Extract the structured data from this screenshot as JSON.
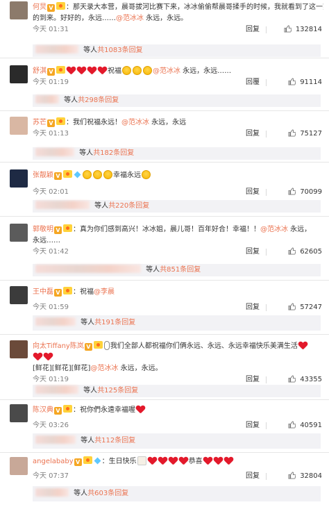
{
  "comments": [
    {
      "name": "何炅",
      "text": "：那天录大本营，晨哥拔河比赛下来，冰冰偷偷帮晨哥揉手的时候，我就看到了这一刻",
      "text2": "的到来。好好的，永远……",
      "mention": "@范冰冰",
      "after_mention": " 永远，永远。",
      "time": "今天 01:31",
      "reply": "回复",
      "likes": "132814",
      "sub_suffix": " 等人",
      "sub_count": "共1083条回复",
      "avatar_color": "#8c7a6b"
    },
    {
      "name": "舒淇",
      "text": "祝福",
      "mention": "@范冰冰",
      "after_mention": " 永远，永远……",
      "time": "今天 01:19",
      "reply": "回覆",
      "likes": "91114",
      "sub_suffix": " 等人",
      "sub_count": "共298条回复",
      "avatar_color": "#2a2a2a"
    },
    {
      "name": "苏芒",
      "text": "：我们祝福永远！",
      "mention": "@范冰冰",
      "after_mention": " 永远，永远",
      "time": "今天 01:13",
      "reply": "回复",
      "likes": "75127",
      "sub_suffix": " 等人",
      "sub_count": "共182条回复",
      "avatar_color": "#d9b7a3"
    },
    {
      "name": "张靓颖",
      "text": "幸福永远",
      "time": "今天 02:01",
      "reply": "回复",
      "likes": "70099",
      "sub_suffix": " 等人",
      "sub_count": "共220条回复",
      "avatar_color": "#1e2a44"
    },
    {
      "name": "郭敬明",
      "text": "：真为你们感到高兴！冰冰姐，晨儿哥！百年好合！幸福！！",
      "mention": "@范冰冰",
      "after_mention": " 永远，",
      "text2": "永远……",
      "time": "今天 01:42",
      "reply": "回复",
      "likes": "62605",
      "sub_suffix": " 等人",
      "sub_count": "共851条回复",
      "avatar_color": "#5b5b5b"
    },
    {
      "name": "王中磊",
      "text": "：祝福",
      "mention": "@李晨",
      "time": "今天 01:59",
      "reply": "回复",
      "likes": "57247",
      "sub_suffix": " 等人",
      "sub_count": "共191条回复",
      "avatar_color": "#3b3b3b"
    },
    {
      "name": "向太Tiffany陈岚",
      "text": "我们全部人都祝福你们俩永远、永远、永远幸福快乐美满生活",
      "text2": "[鲜花][鲜花][鲜花]",
      "mention": "@范冰冰",
      "after_mention": " 永远，永远。",
      "time": "今天 01:19",
      "reply": "回复",
      "likes": "43355",
      "sub_suffix": " 等人",
      "sub_count": "共125条回复",
      "avatar_color": "#6b4a3a"
    },
    {
      "name": "陈汉典",
      "text": "：祝你們永遠幸福喔",
      "time": "今天 03:26",
      "reply": "回复",
      "likes": "40591",
      "sub_suffix": " 等人",
      "sub_count": "共112条回复",
      "avatar_color": "#4a4a4a"
    },
    {
      "name": "angelababy",
      "text": "：生日快乐",
      "text_mid": "恭喜",
      "time": "今天 07:37",
      "reply": "回复",
      "likes": "32804",
      "sub_suffix": " 等人",
      "sub_count": "共603条回复",
      "avatar_color": "#c8a898"
    }
  ],
  "colors": {
    "accent": "#eb7350",
    "subbox_bg": "#f2f2f5",
    "heart": "#e3192b"
  }
}
